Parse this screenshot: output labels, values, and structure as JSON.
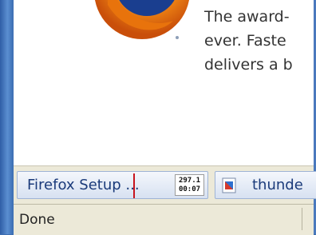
{
  "promo": {
    "lines": [
      "The award-",
      "ever. Faste",
      "delivers a b"
    ]
  },
  "downloads": [
    {
      "label": "Firefox Setup ...",
      "size": "297.1",
      "time": "00:07",
      "progress_percent": 62
    },
    {
      "label": "thunde",
      "icon": "document-icon"
    }
  ],
  "status": {
    "text": "Done"
  },
  "colors": {
    "accent": "#c8141e",
    "frame": "#3d6eb1"
  }
}
